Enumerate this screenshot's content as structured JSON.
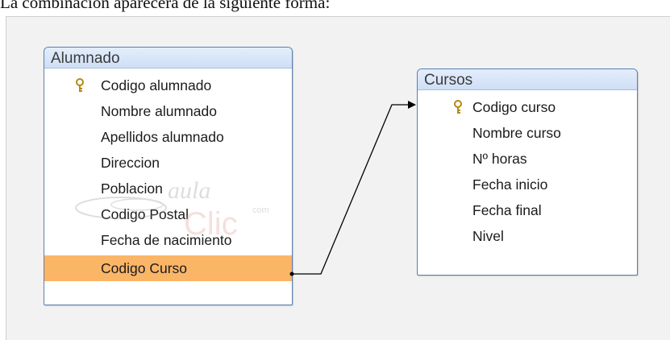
{
  "caption": "La combinación aparecerá de la siguiente forma:",
  "tables": [
    {
      "title": "Alumnado",
      "fields": [
        {
          "label": "Codigo alumnado",
          "primary_key": true
        },
        {
          "label": "Nombre alumnado"
        },
        {
          "label": "Apellidos alumnado"
        },
        {
          "label": "Direccion"
        },
        {
          "label": "Poblacion"
        },
        {
          "label": "Codigo Postal"
        },
        {
          "label": "Fecha de nacimiento"
        },
        {
          "label": "Codigo Curso",
          "selected": true
        }
      ]
    },
    {
      "title": "Cursos",
      "fields": [
        {
          "label": "Codigo curso",
          "primary_key": true
        },
        {
          "label": "Nombre curso"
        },
        {
          "label": "Nº horas"
        },
        {
          "label": "Fecha inicio"
        },
        {
          "label": "Fecha final"
        },
        {
          "label": "Nivel"
        }
      ]
    }
  ],
  "relationship": {
    "from": "Alumnado.Codigo Curso",
    "to": "Cursos.Codigo curso"
  },
  "watermark": {
    "line1": "aula",
    "line2": "Clic",
    "small": "com"
  },
  "colors": {
    "selected_row": "#fbb567",
    "title_bar": "#d6e4f7",
    "table_border": "#5a7fb0"
  }
}
